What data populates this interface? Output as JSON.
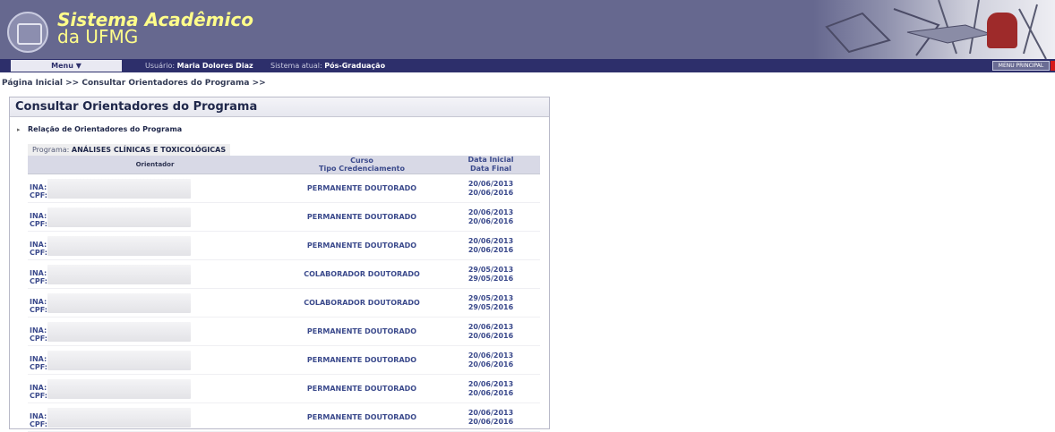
{
  "header": {
    "title": "Sistema Acadêmico",
    "subtitle": "da UFMG"
  },
  "topbar": {
    "menu_label": "Menu ▼",
    "usuario_label": "Usuário:",
    "usuario_name": "Maria Dolores Diaz",
    "sistema_label": "Sistema atual:",
    "sistema_value": "Pós-Graduação",
    "menu_principal": "MENU PRINCIPAL"
  },
  "breadcrumb": "Página Inicial >> Consultar Orientadores do Programa >>",
  "panel": {
    "title": "Consultar Orientadores do Programa",
    "section": "Relação de Orientadores do Programa",
    "program_label": "Programa:",
    "program_name": "ANÁLISES CLÍNICAS E TOXICOLÓGICAS"
  },
  "table": {
    "headers": {
      "orientador": "Orientador",
      "curso": "Curso",
      "tipo": "Tipo Credenciamento",
      "data_inicial": "Data Inicial",
      "data_final": "Data Final"
    },
    "rows": [
      {
        "ina": "INA:",
        "cpf": "CPF:",
        "curso": "PERMANENTE DOUTORADO",
        "inicial": "20/06/2013",
        "final": "20/06/2016"
      },
      {
        "ina": "INA:",
        "cpf": "CPF:",
        "curso": "PERMANENTE DOUTORADO",
        "inicial": "20/06/2013",
        "final": "20/06/2016"
      },
      {
        "ina": "INA:",
        "cpf": "CPF:",
        "curso": "PERMANENTE DOUTORADO",
        "inicial": "20/06/2013",
        "final": "20/06/2016"
      },
      {
        "ina": "INA:",
        "cpf": "CPF:",
        "curso": "COLABORADOR DOUTORADO",
        "inicial": "29/05/2013",
        "final": "29/05/2016"
      },
      {
        "ina": "INA:",
        "cpf": "CPF:",
        "curso": "COLABORADOR DOUTORADO",
        "inicial": "29/05/2013",
        "final": "29/05/2016"
      },
      {
        "ina": "INA:",
        "cpf": "CPF:",
        "curso": "PERMANENTE DOUTORADO",
        "inicial": "20/06/2013",
        "final": "20/06/2016"
      },
      {
        "ina": "INA:",
        "cpf": "CPF:",
        "curso": "PERMANENTE DOUTORADO",
        "inicial": "20/06/2013",
        "final": "20/06/2016"
      },
      {
        "ina": "INA:",
        "cpf": "CPF:",
        "curso": "PERMANENTE DOUTORADO",
        "inicial": "20/06/2013",
        "final": "20/06/2016"
      },
      {
        "ina": "INA:",
        "cpf": "CPF:",
        "curso": "PERMANENTE DOUTORADO",
        "inicial": "20/06/2013",
        "final": "20/06/2016"
      }
    ]
  }
}
